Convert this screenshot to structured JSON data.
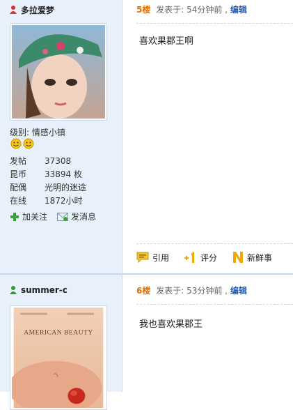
{
  "posts": [
    {
      "username": "多拉爱梦",
      "floor": "5楼",
      "posted_prefix": "发表于:",
      "time": "54分钟前",
      "edit_label": "编辑",
      "content": "喜欢果郡王啊",
      "level_label": "级别:",
      "level_value": "情感小镇",
      "stats": [
        {
          "key": "发帖",
          "value": "37308"
        },
        {
          "key": "昆币",
          "value": "33894 枚"
        },
        {
          "key": "配偶",
          "value": "光明的迷途"
        },
        {
          "key": "在线",
          "value": "1872小时"
        }
      ],
      "follow_label": "加关注",
      "message_label": "发消息",
      "quote_label": "引用",
      "rate_label": "评分",
      "news_label": "新鲜事",
      "gender": "female",
      "icon_color": "#d93030"
    },
    {
      "username": "summer-c",
      "floor": "6楼",
      "posted_prefix": "发表于:",
      "time": "53分钟前",
      "edit_label": "编辑",
      "content": "我也喜欢果郡王",
      "avatar_text": "AMERICAN BEAUTY",
      "gender": "male",
      "icon_color": "#2f9a2f"
    }
  ],
  "colors": {
    "floor": "#e07000",
    "link": "#2a5db0",
    "sidebar": "#e8f0fb"
  },
  "icons": [
    "user-female-icon",
    "smiley-icon",
    "plus-icon",
    "envelope-icon",
    "quote-icon",
    "rate-icon",
    "news-icon",
    "user-male-icon"
  ]
}
